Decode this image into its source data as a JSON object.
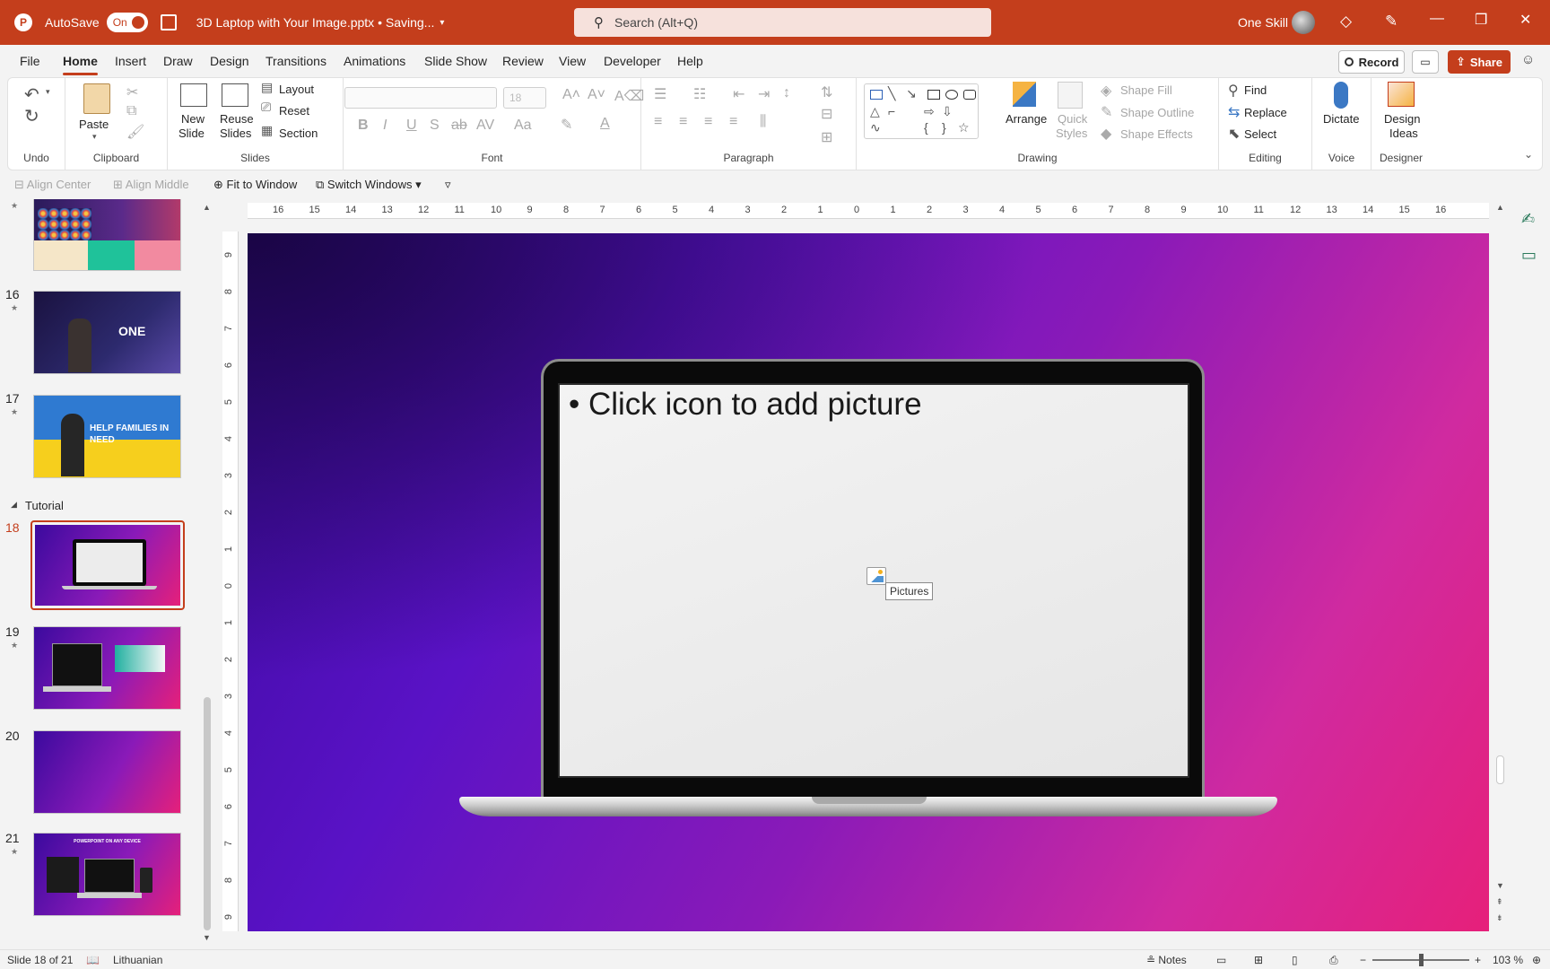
{
  "titlebar": {
    "logo": "P",
    "autosave_label": "AutoSave",
    "autosave_state": "On",
    "filename": "3D Laptop with Your Image.pptx • Saving...",
    "search_placeholder": "Search (Alt+Q)",
    "user_name": "One Skill"
  },
  "menu": {
    "tabs": [
      "File",
      "Home",
      "Insert",
      "Draw",
      "Design",
      "Transitions",
      "Animations",
      "Slide Show",
      "Review",
      "View",
      "Developer",
      "Help"
    ],
    "active_tab": "Home",
    "record_label": "Record",
    "share_label": "Share"
  },
  "ribbon": {
    "undo_label": "Undo",
    "clipboard_label": "Clipboard",
    "paste_label": "Paste",
    "slides_label": "Slides",
    "new_slide_line1": "New",
    "new_slide_line2": "Slide",
    "reuse_line1": "Reuse",
    "reuse_line2": "Slides",
    "layout_label": "Layout",
    "reset_label": "Reset",
    "section_label": "Section",
    "font_label": "Font",
    "font_size": "18",
    "paragraph_label": "Paragraph",
    "drawing_label": "Drawing",
    "arrange_label": "Arrange",
    "quick_styles_line1": "Quick",
    "quick_styles_line2": "Styles",
    "shape_fill_label": "Shape Fill",
    "shape_outline_label": "Shape Outline",
    "shape_effects_label": "Shape Effects",
    "editing_label": "Editing",
    "find_label": "Find",
    "replace_label": "Replace",
    "select_label": "Select",
    "voice_label": "Voice",
    "dictate_label": "Dictate",
    "designer_label": "Designer",
    "design_ideas_line1": "Design",
    "design_ideas_line2": "Ideas"
  },
  "quickaccess": {
    "align_center": "Align Center",
    "align_middle": "Align Middle",
    "fit_to_window": "Fit to Window",
    "switch_windows": "Switch Windows"
  },
  "thumbnails": {
    "section_name": "Tutorial",
    "numbers": [
      "16",
      "17",
      "18",
      "19",
      "20",
      "21"
    ],
    "selected": "18",
    "thumb17_text": "HELP FAMILIES IN NEED",
    "thumb21_text": "POWERPOINT ON ANY DEVICE"
  },
  "rulers": {
    "horizontal": [
      "16",
      "15",
      "14",
      "13",
      "12",
      "11",
      "10",
      "9",
      "8",
      "7",
      "6",
      "5",
      "4",
      "3",
      "2",
      "1",
      "0",
      "1",
      "2",
      "3",
      "4",
      "5",
      "6",
      "7",
      "8",
      "9",
      "10",
      "11",
      "12",
      "13",
      "14",
      "15",
      "16"
    ],
    "vertical": [
      "9",
      "8",
      "7",
      "6",
      "5",
      "4",
      "3",
      "2",
      "1",
      "0",
      "1",
      "2",
      "3",
      "4",
      "5",
      "6",
      "7",
      "8",
      "9"
    ]
  },
  "slide": {
    "placeholder_text": "• Click icon to add picture",
    "tooltip": "Pictures"
  },
  "statusbar": {
    "slide_info": "Slide 18 of 21",
    "language": "Lithuanian",
    "notes_label": "Notes",
    "zoom": "103 %"
  }
}
